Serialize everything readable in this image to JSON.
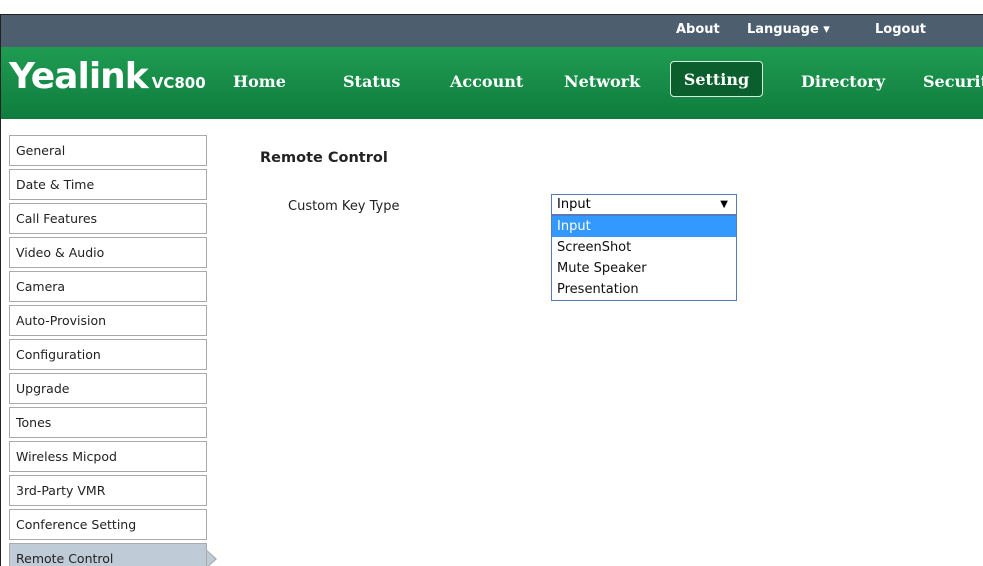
{
  "topbar": {
    "about": "About",
    "language": "Language ▾",
    "logout": "Logout"
  },
  "brand": {
    "name": "Yealink",
    "model": "VC800"
  },
  "nav": {
    "home": "Home",
    "status": "Status",
    "account": "Account",
    "network": "Network",
    "setting": "Setting",
    "directory": "Directory",
    "security": "Security"
  },
  "sidebar": {
    "items": [
      {
        "label": "General"
      },
      {
        "label": "Date & Time"
      },
      {
        "label": "Call Features"
      },
      {
        "label": "Video & Audio"
      },
      {
        "label": "Camera"
      },
      {
        "label": "Auto-Provision"
      },
      {
        "label": "Configuration"
      },
      {
        "label": "Upgrade"
      },
      {
        "label": "Tones"
      },
      {
        "label": "Wireless Micpod"
      },
      {
        "label": "3rd-Party VMR"
      },
      {
        "label": "Conference Setting"
      },
      {
        "label": "Remote Control"
      }
    ],
    "active_index": 12
  },
  "main": {
    "title": "Remote Control",
    "field_label": "Custom Key Type",
    "select_value": "Input",
    "options": [
      "Input",
      "ScreenShot",
      "Mute Speaker",
      "Presentation"
    ],
    "highlighted_option": "Input"
  }
}
